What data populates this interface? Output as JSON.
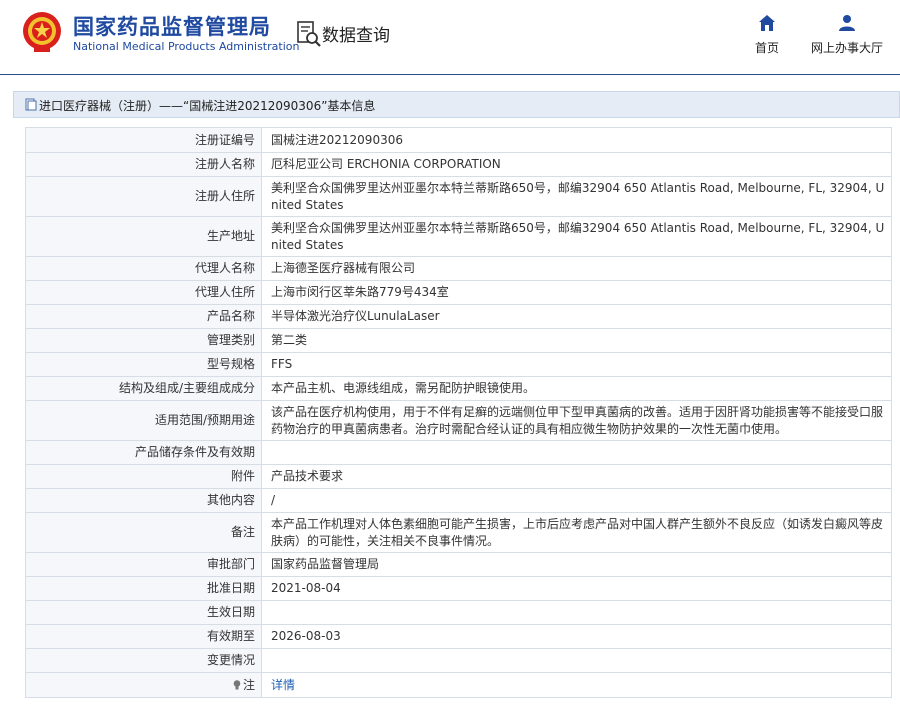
{
  "header": {
    "org_name_cn": "国家药品监督管理局",
    "org_name_en": "National Medical Products Administration",
    "section_title": "数据查询",
    "nav": {
      "home_label": "首页",
      "online_office_label": "网上办事大厅"
    },
    "emblem_icon": "national-emblem-icon",
    "search_icon": "data-query-icon",
    "home_icon": "home-icon",
    "person_icon": "person-icon",
    "brand_color": "#1f4aa0"
  },
  "title_bar": {
    "text": "进口医疗器械（注册）——“国械注进20212090306”基本信息",
    "icon": "document-icon"
  },
  "rows": [
    {
      "label": "注册证编号",
      "value": "国械注进20212090306"
    },
    {
      "label": "注册人名称",
      "value": "厄科尼亚公司 ERCHONIA CORPORATION"
    },
    {
      "label": "注册人住所",
      "value": "美利坚合众国佛罗里达州亚墨尔本特兰蒂斯路650号，邮编32904 650 Atlantis Road, Melbourne, FL, 32904, United States"
    },
    {
      "label": "生产地址",
      "value": "美利坚合众国佛罗里达州亚墨尔本特兰蒂斯路650号，邮编32904 650 Atlantis Road, Melbourne, FL, 32904, United States"
    },
    {
      "label": "代理人名称",
      "value": "上海德圣医疗器械有限公司"
    },
    {
      "label": "代理人住所",
      "value": "上海市闵行区莘朱路779号434室"
    },
    {
      "label": "产品名称",
      "value": "半导体激光治疗仪LunulaLaser"
    },
    {
      "label": "管理类别",
      "value": "第二类"
    },
    {
      "label": "型号规格",
      "value": "FFS"
    },
    {
      "label": "结构及组成/主要组成成分",
      "value": "本产品主机、电源线组成，需另配防护眼镜使用。"
    },
    {
      "label": "适用范围/预期用途",
      "value": "该产品在医疗机构使用，用于不伴有足癣的远端侧位甲下型甲真菌病的改善。适用于因肝肾功能损害等不能接受口服药物治疗的甲真菌病患者。治疗时需配合经认证的具有相应微生物防护效果的一次性无菌巾使用。"
    },
    {
      "label": "产品储存条件及有效期",
      "value": ""
    },
    {
      "label": "附件",
      "value": "产品技术要求"
    },
    {
      "label": "其他内容",
      "value": "/"
    },
    {
      "label": "备注",
      "value": "本产品工作机理对人体色素细胞可能产生损害，上市后应考虑产品对中国人群产生额外不良反应（如诱发白癜风等皮肤病）的可能性，关注相关不良事件情况。"
    },
    {
      "label": "审批部门",
      "value": "国家药品监督管理局"
    },
    {
      "label": "批准日期",
      "value": "2021-08-04"
    },
    {
      "label": "生效日期",
      "value": ""
    },
    {
      "label": "有效期至",
      "value": "2026-08-03"
    },
    {
      "label": "变更情况",
      "value": ""
    }
  ],
  "note_row": {
    "label": "注",
    "link_text": "详情",
    "icon": "lightbulb-icon"
  }
}
